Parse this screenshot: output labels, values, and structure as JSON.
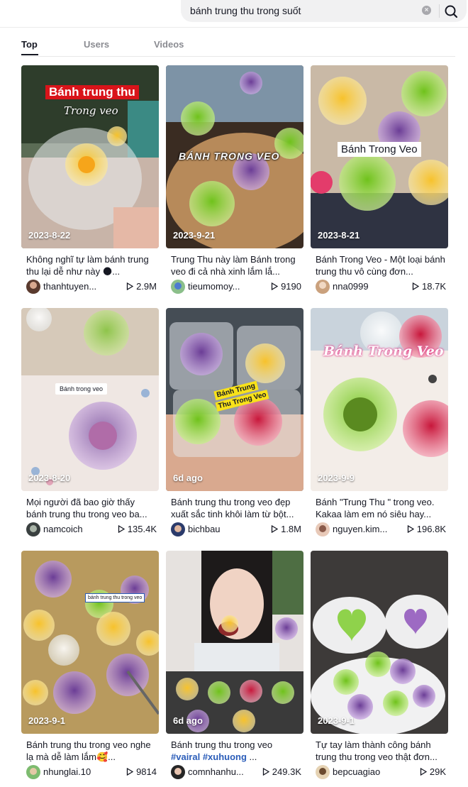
{
  "search": {
    "query": "bánh trung thu trong suốt",
    "clear_icon": "clear-icon",
    "search_icon": "search-icon"
  },
  "tabs": [
    {
      "label": "Top",
      "active": true
    },
    {
      "label": "Users",
      "active": false
    },
    {
      "label": "Videos",
      "active": false
    }
  ],
  "cards": [
    {
      "date": "2023-8-22",
      "overlay": "Bánh trung thu",
      "overlay2": "Trong veo",
      "desc": "Không nghĩ tự làm bánh trung thu lại dễ như này 🌑...",
      "user": "thanhtuyen...",
      "plays": "2.9M"
    },
    {
      "date": "2023-9-21",
      "overlay": "BÁNH TRONG VEO",
      "overlay2": "",
      "desc": "Trung Thu này làm Bánh trong veo đi cả nhà xinh lắm lắ...",
      "user": "tieumomoy...",
      "plays": "9190"
    },
    {
      "date": "2023-8-21",
      "overlay": "Bánh Trong Veo",
      "overlay2": "",
      "desc": "Bánh Trong Veo - Một loại bánh trung thu vô cùng đơn...",
      "user": "nna0999",
      "plays": "18.7K"
    },
    {
      "date": "2023-8-20",
      "overlay": "Bánh trong veo",
      "overlay2": "",
      "desc": "Mọi người đã bao giờ thấy bánh trung thu trong veo ba...",
      "user": "namcoich",
      "plays": "135.4K"
    },
    {
      "date": "6d ago",
      "overlay": "Bánh Trung",
      "overlay2": "Thu Trong Veo",
      "desc": "Bánh trung thu trong veo đẹp xuất sắc tinh khôi làm từ bột...",
      "user": "bichbau",
      "plays": "1.8M"
    },
    {
      "date": "2023-9-9",
      "overlay": "Bánh Trong Veo",
      "overlay2": "",
      "desc": "Bánh \"Trung Thu \" trong veo. Kakaa làm em nó siêu hay...",
      "user": "nguyen.kim...",
      "plays": "196.8K"
    },
    {
      "date": "2023-9-1",
      "overlay": "bánh trung thu trong veo",
      "overlay2": "",
      "desc": "Bánh trung thu trong veo nghe lạ mà dễ làm lắm🥰...",
      "user": "nhunglai.10",
      "plays": "9814"
    },
    {
      "date": "6d ago",
      "overlay": "",
      "overlay2": "",
      "desc_line1": "Bánh trung thu trong veo",
      "desc_tags": "#vairal #xuhuong",
      "desc_more": "...",
      "user": "comnhanhu...",
      "plays": "249.3K"
    },
    {
      "date": "2023-9-1",
      "overlay": "",
      "overlay2": "",
      "desc": "Tự tay làm thành công bánh trung thu trong veo thật đơn...",
      "user": "bepcuagiao",
      "plays": "29K"
    }
  ]
}
